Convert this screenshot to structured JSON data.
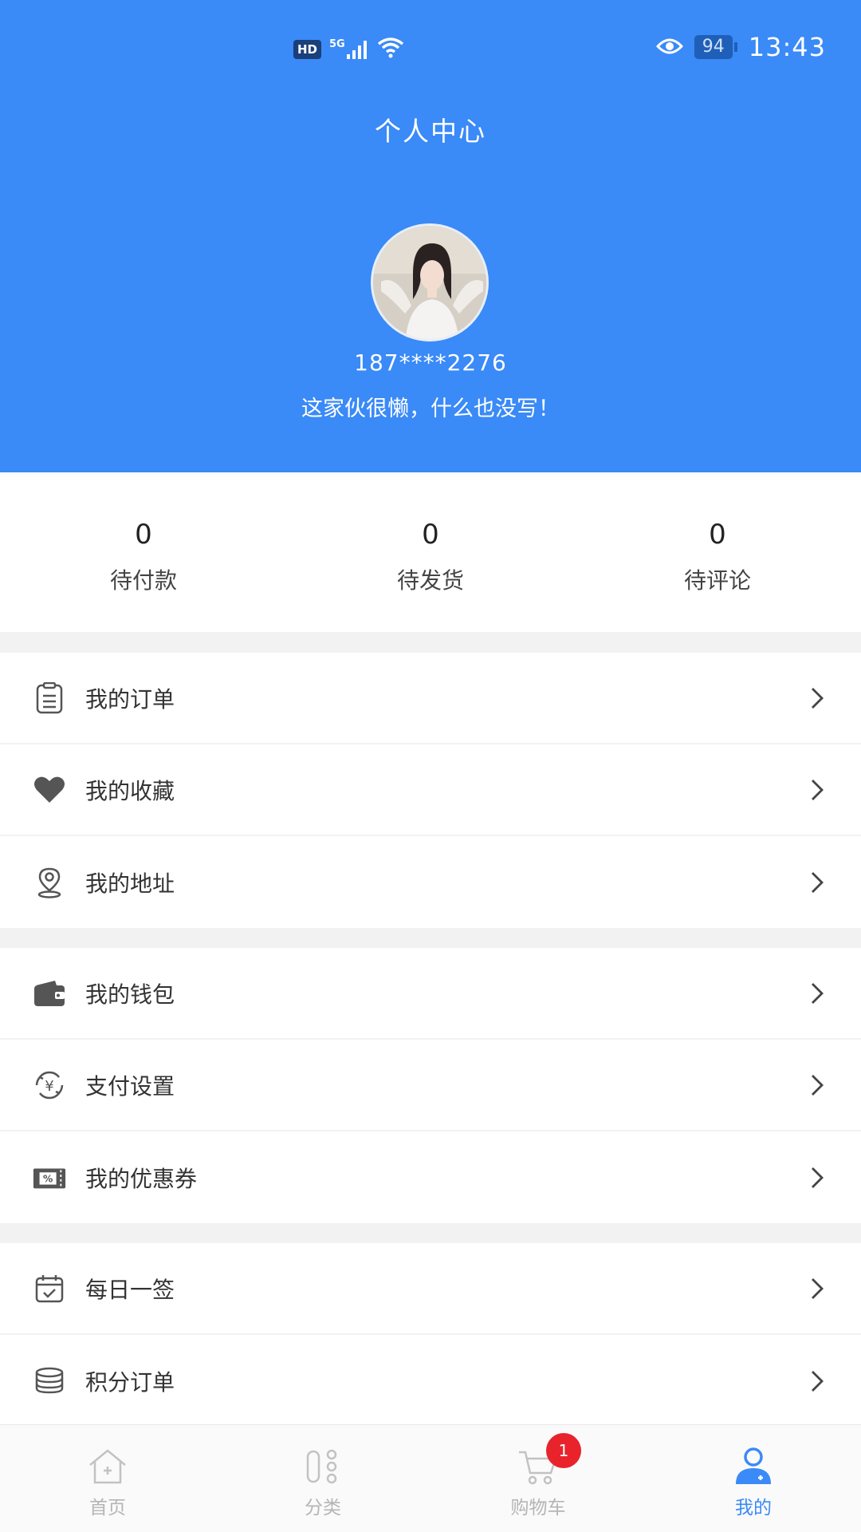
{
  "status_bar": {
    "hd": "HD",
    "network": "5G",
    "battery": "94",
    "time": "13:43"
  },
  "header": {
    "title": "个人中心",
    "phone": "187****2276",
    "signature": "这家伙很懒，什么也没写！"
  },
  "stats": [
    {
      "value": "0",
      "label": "待付款"
    },
    {
      "value": "0",
      "label": "待发货"
    },
    {
      "value": "0",
      "label": "待评论"
    }
  ],
  "menu": {
    "group1": [
      {
        "label": "我的订单",
        "icon": "order-list-icon"
      },
      {
        "label": "我的收藏",
        "icon": "heart-icon"
      },
      {
        "label": "我的地址",
        "icon": "location-pin-icon"
      }
    ],
    "group2": [
      {
        "label": "我的钱包",
        "icon": "wallet-icon"
      },
      {
        "label": "支付设置",
        "icon": "yuan-cycle-icon"
      },
      {
        "label": "我的优惠券",
        "icon": "coupon-icon"
      }
    ],
    "group3": [
      {
        "label": "每日一签",
        "icon": "calendar-check-icon"
      },
      {
        "label": "积分订单",
        "icon": "coins-stack-icon"
      }
    ]
  },
  "tabbar": {
    "items": [
      {
        "label": "首页",
        "icon": "home-icon"
      },
      {
        "label": "分类",
        "icon": "category-icon"
      },
      {
        "label": "购物车",
        "icon": "cart-icon",
        "badge": "1"
      },
      {
        "label": "我的",
        "icon": "user-icon",
        "active": true
      }
    ]
  },
  "colors": {
    "accent": "#3a8af7",
    "badge": "#e8232c",
    "inactive": "#b5b5b5"
  }
}
